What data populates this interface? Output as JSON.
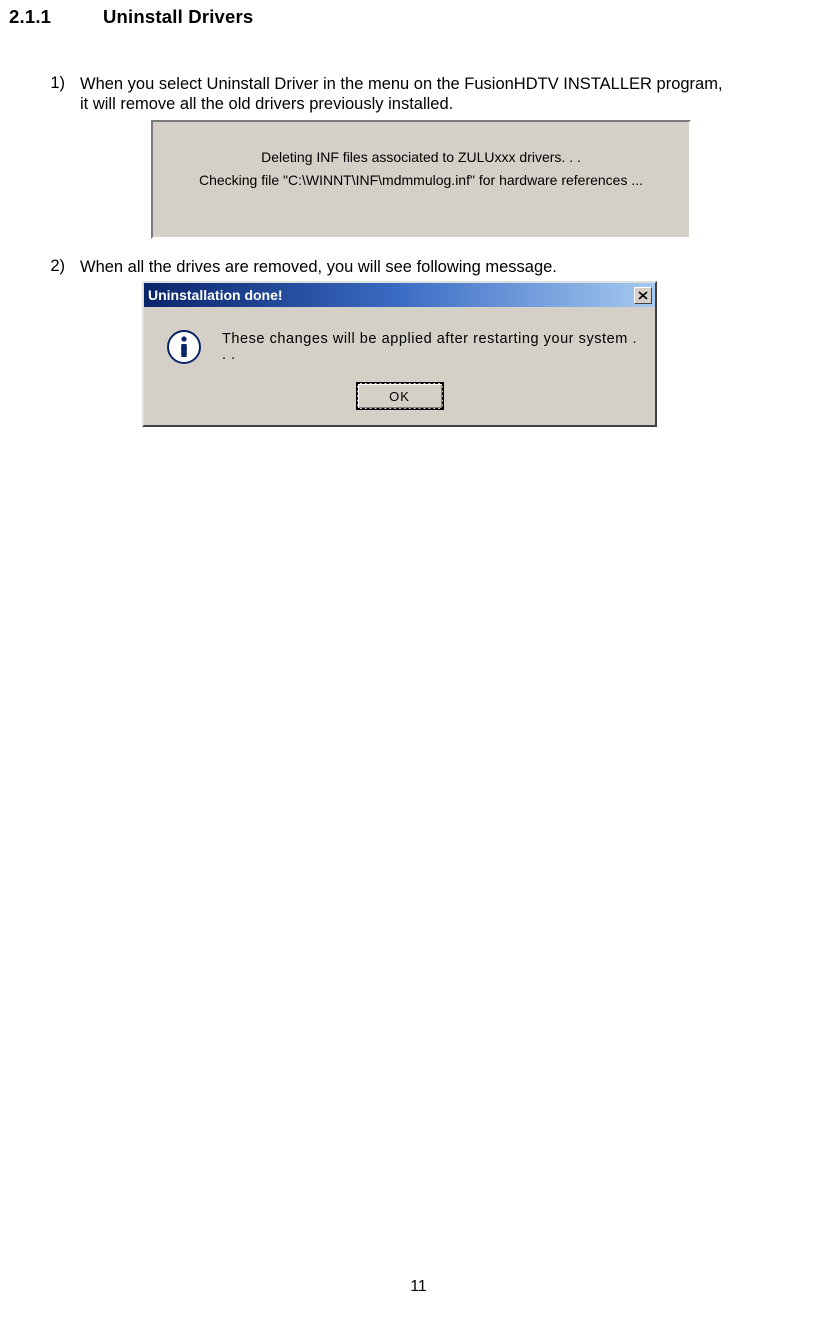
{
  "heading": {
    "number": "2.1.1",
    "title": "Uninstall Drivers"
  },
  "items": [
    {
      "num": "1)",
      "line1": "When you select Uninstall Driver in the menu on the FusionHDTV INSTALLER program,",
      "line2": "it will remove all the old drivers previously installed."
    },
    {
      "num": "2)",
      "line1": "When all the drives are removed, you will see following message."
    }
  ],
  "panel1": {
    "line1": "Deleting INF files associated to ZULUxxx drivers. . .",
    "line2": "Checking file \"C:\\WINNT\\INF\\mdmmulog.inf\" for hardware references ..."
  },
  "dialog": {
    "title": "Uninstallation done!",
    "message": "These changes will be applied after restarting your system . . .",
    "ok": "OK"
  },
  "pageNumber": "11"
}
